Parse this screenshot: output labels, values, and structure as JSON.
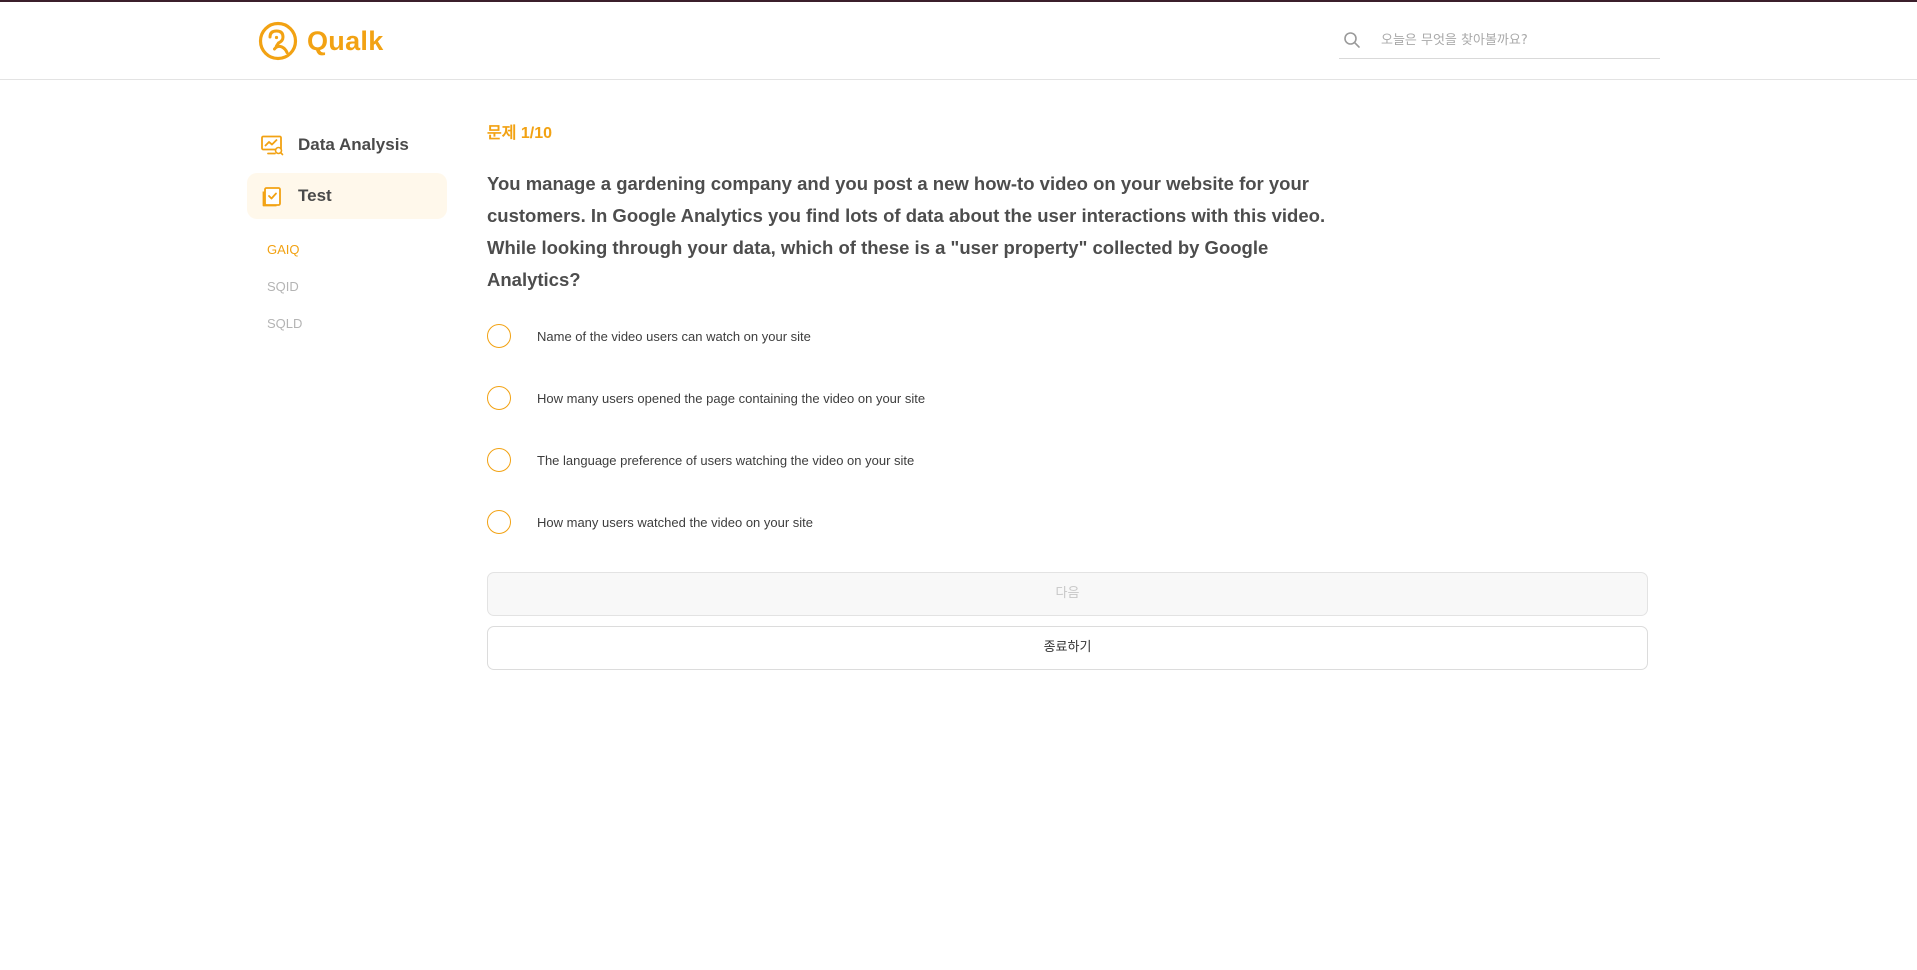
{
  "brand": {
    "name": "Qualk",
    "accent_color": "#f2a213",
    "logo_icon": "qualk-logo-icon"
  },
  "search": {
    "placeholder": "오늘은 무엇을 찾아볼까요?",
    "icon": "search-icon"
  },
  "sidebar": {
    "items": [
      {
        "label": "Data Analysis",
        "icon": "monitor-chart-icon",
        "active": false
      },
      {
        "label": "Test",
        "icon": "checklist-icon",
        "active": true
      }
    ],
    "sub_items": [
      {
        "label": "GAIQ",
        "active": true
      },
      {
        "label": "SQID",
        "active": false
      },
      {
        "label": "SQLD",
        "active": false
      }
    ]
  },
  "quiz": {
    "progress_label": "문제 1/10",
    "question": "You manage a gardening company and you post a new how-to video on your website for your customers. In Google Analytics you find lots of data about the user interactions with this video. While looking through your data, which of these is a \"user property\" collected by Google Analytics?",
    "options": [
      "Name of the video users can watch on your site",
      "How many users opened the page containing the video on your site",
      "The language preference of users watching the video on your site",
      "How many users watched the video on your site"
    ],
    "next_label": "다음",
    "exit_label": "종료하기"
  }
}
